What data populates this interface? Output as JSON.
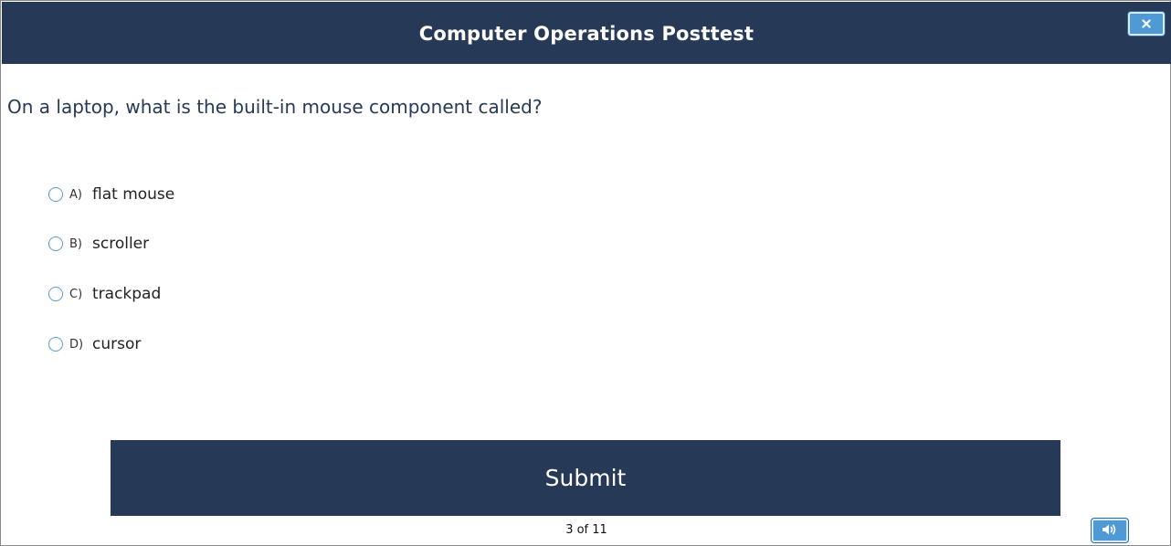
{
  "header": {
    "title": "Computer Operations Posttest",
    "background": "#263a57",
    "close_icon": "close-icon"
  },
  "question": {
    "text": "On a laptop, what is the built-in mouse component called?"
  },
  "options": [
    {
      "letter": "A)",
      "text": "flat mouse",
      "selected": false
    },
    {
      "letter": "B)",
      "text": "scroller",
      "selected": false
    },
    {
      "letter": "C)",
      "text": "trackpad",
      "selected": false
    },
    {
      "letter": "D)",
      "text": "cursor",
      "selected": false
    }
  ],
  "submit": {
    "label": "Submit"
  },
  "pager": {
    "text": "3 of 11"
  },
  "audio": {
    "icon": "speaker-icon"
  },
  "colors": {
    "accent": "#4f9ad4",
    "navy": "#263a57",
    "radio_border": "#5b9bd5"
  }
}
